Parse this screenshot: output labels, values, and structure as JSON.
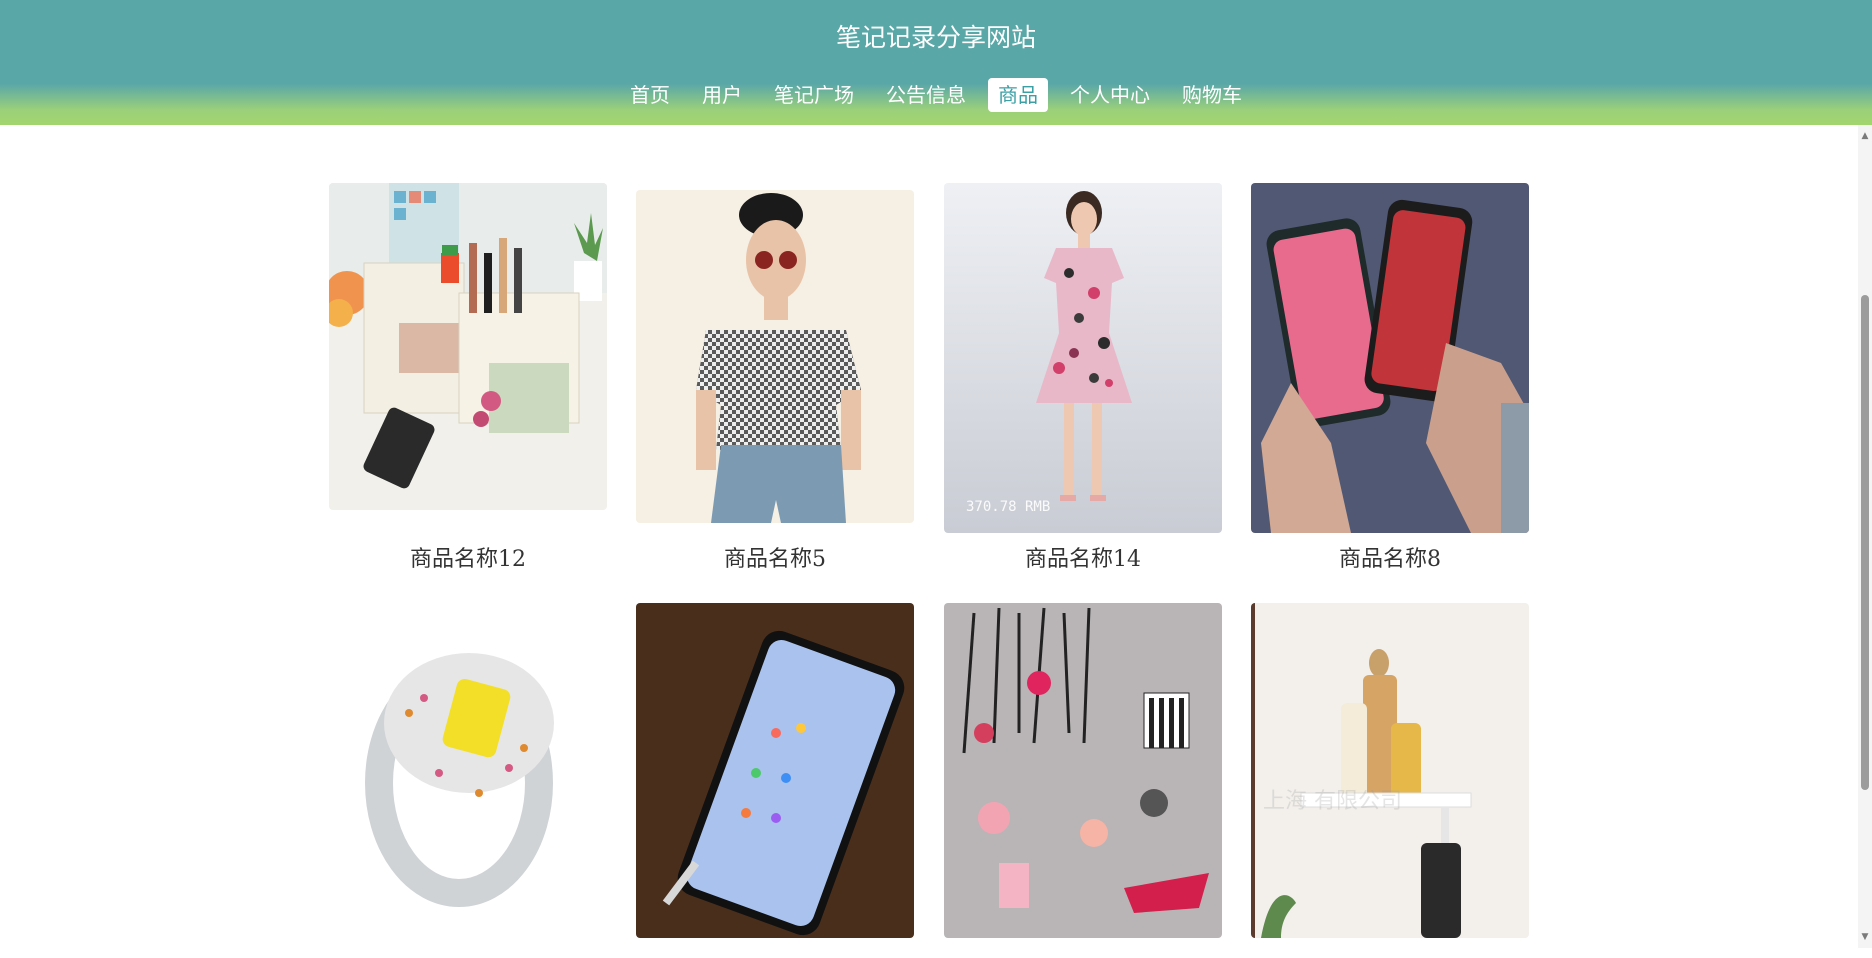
{
  "site": {
    "title": "笔记记录分享网站"
  },
  "nav": {
    "items": [
      "首页",
      "用户",
      "笔记广场",
      "公告信息",
      "商品",
      "个人中心",
      "购物车"
    ],
    "active_index": 4
  },
  "products": {
    "row1": [
      {
        "name": "商品名称12",
        "image": "desk-organizer-photo"
      },
      {
        "name": "商品名称5",
        "image": "fashion-model-photo"
      },
      {
        "name": "商品名称14",
        "image": "floral-dress-photo",
        "price_overlay": "370.78 RMB"
      },
      {
        "name": "商品名称8",
        "image": "smartphones-photo"
      }
    ],
    "row2": [
      {
        "image": "yellow-gem-ring-photo"
      },
      {
        "image": "smartphone-on-table-photo"
      },
      {
        "image": "cosmetics-illustration"
      },
      {
        "image": "bathroom-shelf-photo",
        "watermark": "上海 有限公司"
      }
    ]
  },
  "colors": {
    "header_teal": "#5aa7a8",
    "header_green": "#a3d56d",
    "active_text": "#3aa0a6"
  }
}
